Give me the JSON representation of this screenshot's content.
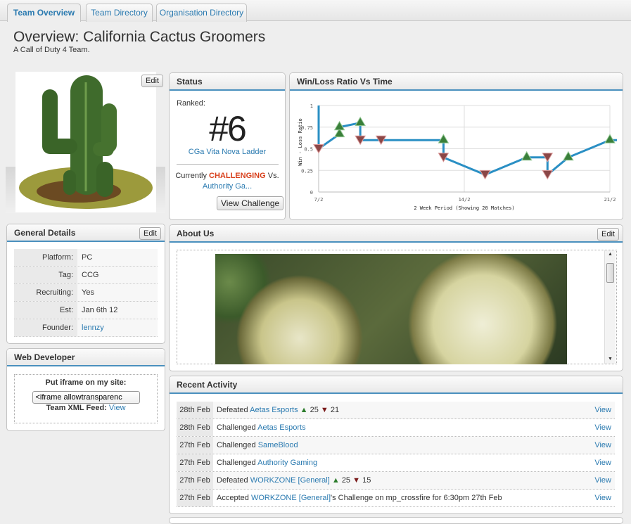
{
  "tabs": [
    {
      "label": "Team Overview",
      "active": true
    },
    {
      "label": "Team Directory"
    },
    {
      "label": "Organisation Directory"
    }
  ],
  "header": {
    "title": "Overview: California Cactus Groomers",
    "subtitle": "A Call of Duty 4 Team."
  },
  "avatar": {
    "edit_label": "Edit"
  },
  "status": {
    "title": "Status",
    "ranked_label": "Ranked:",
    "rank": "#6",
    "ladder": "CGa Vita Nova Ladder",
    "currently": "Currently",
    "state": "CHALLENGING",
    "vs": "Vs.",
    "opponent": "Authority Ga...",
    "button": "View Challenge",
    "state_color": "#d8401c"
  },
  "chart_data": {
    "type": "line",
    "title": "Win/Loss Ratio Vs Time",
    "xlabel": "2 Week Period (Showing 20 Matches)",
    "ylabel": "Win - Loss Ratio",
    "xticks": [
      "7/2",
      "14/2",
      "21/2"
    ],
    "yticks": [
      "0",
      "0.25",
      "0.5",
      "0.75",
      "1"
    ],
    "ylim": [
      0,
      1
    ],
    "xlim": [
      "7/2",
      "21/2"
    ],
    "grid": true,
    "line_color": "#2a8fc4",
    "points": [
      {
        "date": "7/2",
        "ratio": 1,
        "result": ""
      },
      {
        "date": "7/2",
        "ratio": 0.5,
        "result": "loss"
      },
      {
        "date": "8/2",
        "ratio": 0.67,
        "result": "win"
      },
      {
        "date": "8/2",
        "ratio": 0.75,
        "result": "win"
      },
      {
        "date": "9/2",
        "ratio": 0.8,
        "result": "win"
      },
      {
        "date": "9/2",
        "ratio": 0.6,
        "result": "loss"
      },
      {
        "date": "10/2",
        "ratio": 0.6,
        "result": "loss"
      },
      {
        "date": "13/2",
        "ratio": 0.6,
        "result": "win"
      },
      {
        "date": "13/2",
        "ratio": 0.4,
        "result": "loss"
      },
      {
        "date": "15/2",
        "ratio": 0.2,
        "result": "loss"
      },
      {
        "date": "17/2",
        "ratio": 0.4,
        "result": "win"
      },
      {
        "date": "18/2",
        "ratio": 0.4,
        "result": "loss"
      },
      {
        "date": "18/2",
        "ratio": 0.2,
        "result": "loss"
      },
      {
        "date": "19/2",
        "ratio": 0.4,
        "result": "win"
      },
      {
        "date": "21/2",
        "ratio": 0.6,
        "result": "win"
      }
    ]
  },
  "general": {
    "title": "General Details",
    "edit_label": "Edit",
    "rows": [
      {
        "label": "Platform:",
        "value": "PC"
      },
      {
        "label": "Tag:",
        "value": "CCG"
      },
      {
        "label": "Recruiting:",
        "value": "Yes"
      },
      {
        "label": "Est:",
        "value": "Jan 6th 12"
      },
      {
        "label": "Founder:",
        "value": "lennzy",
        "link": true
      }
    ]
  },
  "webdev": {
    "title": "Web Developer",
    "iframe_label": "Put iframe on my site:",
    "iframe_value": "<iframe allowtransparenc",
    "xml_label": "Team XML Feed:",
    "xml_link": "View"
  },
  "about": {
    "title": "About Us",
    "edit_label": "Edit"
  },
  "activity": {
    "title": "Recent Activity",
    "view_label": "View",
    "rows": [
      {
        "date": "28th Feb",
        "action": "Defeated",
        "team": "Aetas Esports",
        "suffix": "",
        "score_for": "25",
        "score_against": "21"
      },
      {
        "date": "28th Feb",
        "action": "Challenged",
        "team": "Aetas Esports",
        "suffix": ""
      },
      {
        "date": "27th Feb",
        "action": "Challenged",
        "team": "SameBlood",
        "suffix": ""
      },
      {
        "date": "27th Feb",
        "action": "Challenged",
        "team": "Authority Gaming",
        "suffix": ""
      },
      {
        "date": "27th Feb",
        "action": "Defeated",
        "team": "WORKZONE [General]",
        "suffix": "",
        "score_for": "25",
        "score_against": "15"
      },
      {
        "date": "27th Feb",
        "action": "Accepted",
        "team": "WORKZONE [General]",
        "suffix": "'s Challenge on mp_crossfire for 6:30pm 27th Feb"
      }
    ]
  }
}
